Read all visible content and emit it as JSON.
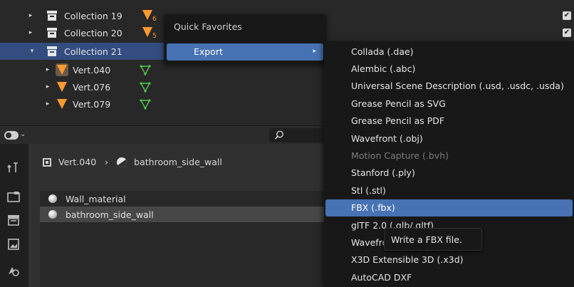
{
  "outliner": {
    "rows": [
      {
        "label": "Collection 19",
        "badge": "6",
        "checked": true
      },
      {
        "label": "Collection 20",
        "badge": "5",
        "checked": true
      },
      {
        "label": "Collection 21"
      },
      {
        "label": "Vert.040"
      },
      {
        "label": "Vert.076"
      },
      {
        "label": "Vert.079"
      }
    ],
    "check_glyph": "✔",
    "expand_glyph": "▸",
    "collapse_glyph": "▾"
  },
  "quick_favorites": {
    "title": "Quick Favorites",
    "export_label": "Export",
    "submenu_glyph": "▸"
  },
  "export_menu": {
    "items": [
      {
        "label": "Collada (.dae)"
      },
      {
        "label": "Alembic (.abc)"
      },
      {
        "label": "Universal Scene Description (.usd, .usdc, .usda)"
      },
      {
        "label": "Grease Pencil as SVG"
      },
      {
        "label": "Grease Pencil as PDF"
      },
      {
        "label": "Wavefront (.obj)"
      },
      {
        "label": "Motion Capture (.bvh)",
        "disabled": true
      },
      {
        "label": "Stanford (.ply)"
      },
      {
        "label": "Stl (.stl)"
      },
      {
        "label": "FBX (.fbx)",
        "hover": true
      },
      {
        "label": "glTF 2.0 (.glb/.gltf)"
      },
      {
        "label": "Wavefront (.obj)"
      },
      {
        "label": "X3D Extensible 3D (.x3d)"
      },
      {
        "label": "AutoCAD DXF"
      }
    ],
    "tooltip": "Write a FBX file."
  },
  "properties": {
    "breadcrumb_object": "Vert.040",
    "breadcrumb_separator": "›",
    "breadcrumb_material": "bathroom_side_wall",
    "materials": [
      "Wall_material",
      "bathroom_side_wall"
    ],
    "dropdown_glyph": "⌄"
  },
  "colors": {
    "selection": "#334d80",
    "menu_highlight": "#4772b3",
    "mesh_orange": "#ff9a2e",
    "vertex_group_green": "#4ec94e"
  },
  "icons": [
    "collection-icon",
    "mesh-icon",
    "vertex-group-icon",
    "checkbox-icon",
    "search-icon",
    "material-sphere-icon",
    "tool-icon",
    "render-icon",
    "output-icon",
    "view-layer-icon",
    "scene-icon"
  ]
}
